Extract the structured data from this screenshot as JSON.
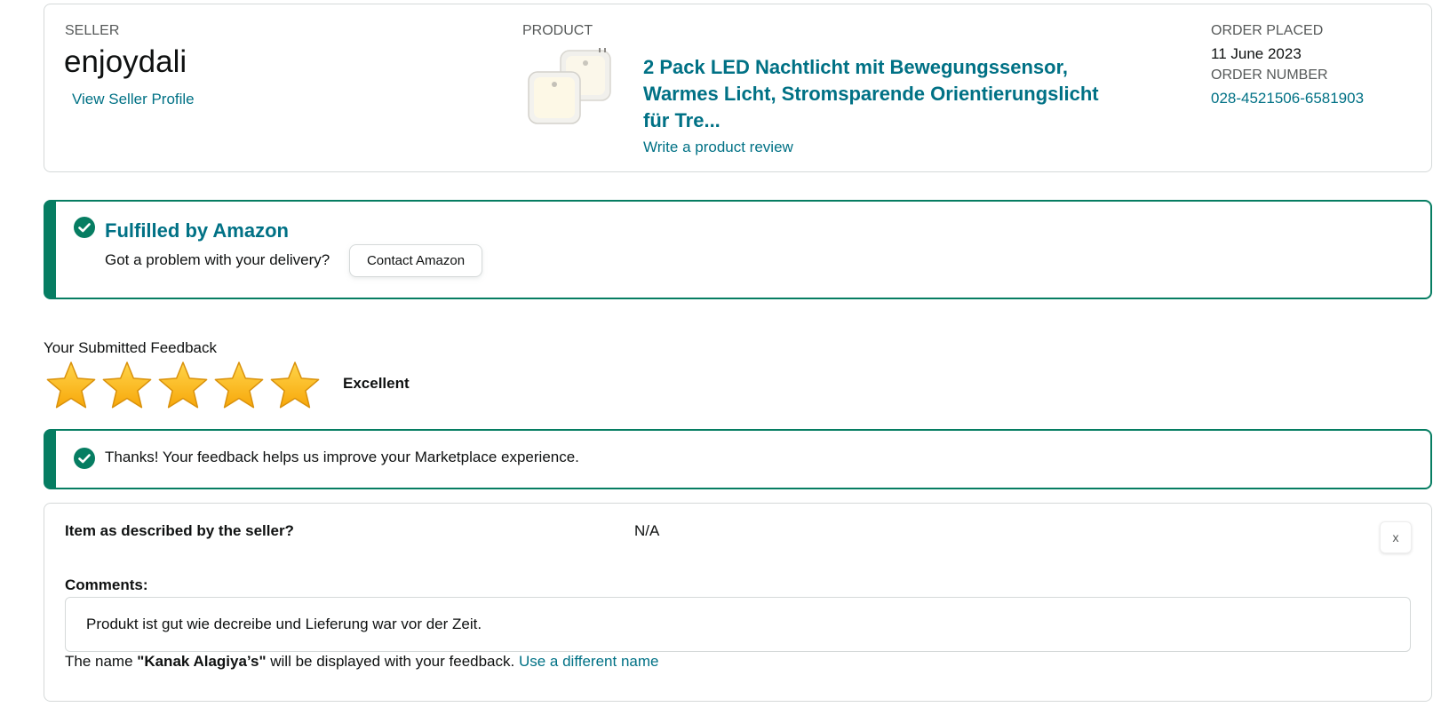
{
  "order": {
    "seller_label": "SELLER",
    "seller_name": "enjoydali",
    "seller_link": "View Seller Profile",
    "product_label": "PRODUCT",
    "product_title": "2 Pack LED Nachtlicht mit Bewegungssensor, Warmes Licht, Stromsparende Orientierungslicht für Tre...",
    "review_link": "Write a product review",
    "placed_label": "ORDER PLACED",
    "placed_date": "11 June 2023",
    "number_label": "ORDER NUMBER",
    "number_value": "028-4521506-6581903"
  },
  "fulfilment": {
    "title": "Fulfilled by Amazon",
    "question": "Got a problem with your delivery?",
    "contact_button": "Contact Amazon",
    "icon": "check-circle-icon"
  },
  "feedback": {
    "heading": "Your Submitted Feedback",
    "rating": 5,
    "rating_max": 5,
    "rating_text": "Excellent",
    "thanks": "Thanks! Your feedback helps us improve your Marketplace experience.",
    "question": "Item as described by the seller?",
    "answer": "N/A",
    "close_label": "x",
    "comments_label": "Comments:",
    "comment": "Produkt ist gut wie decreibe und Lieferung war vor der Zeit.",
    "name_prefix": "The name ",
    "name": "\"Kanak Alagiya’s\"",
    "name_suffix": " will be displayed with your feedback. ",
    "different_name_link": "Use a different name"
  },
  "colors": {
    "link": "#007185",
    "success": "#067D62",
    "star": "#FFA41C",
    "border": "#D5D9D9"
  }
}
